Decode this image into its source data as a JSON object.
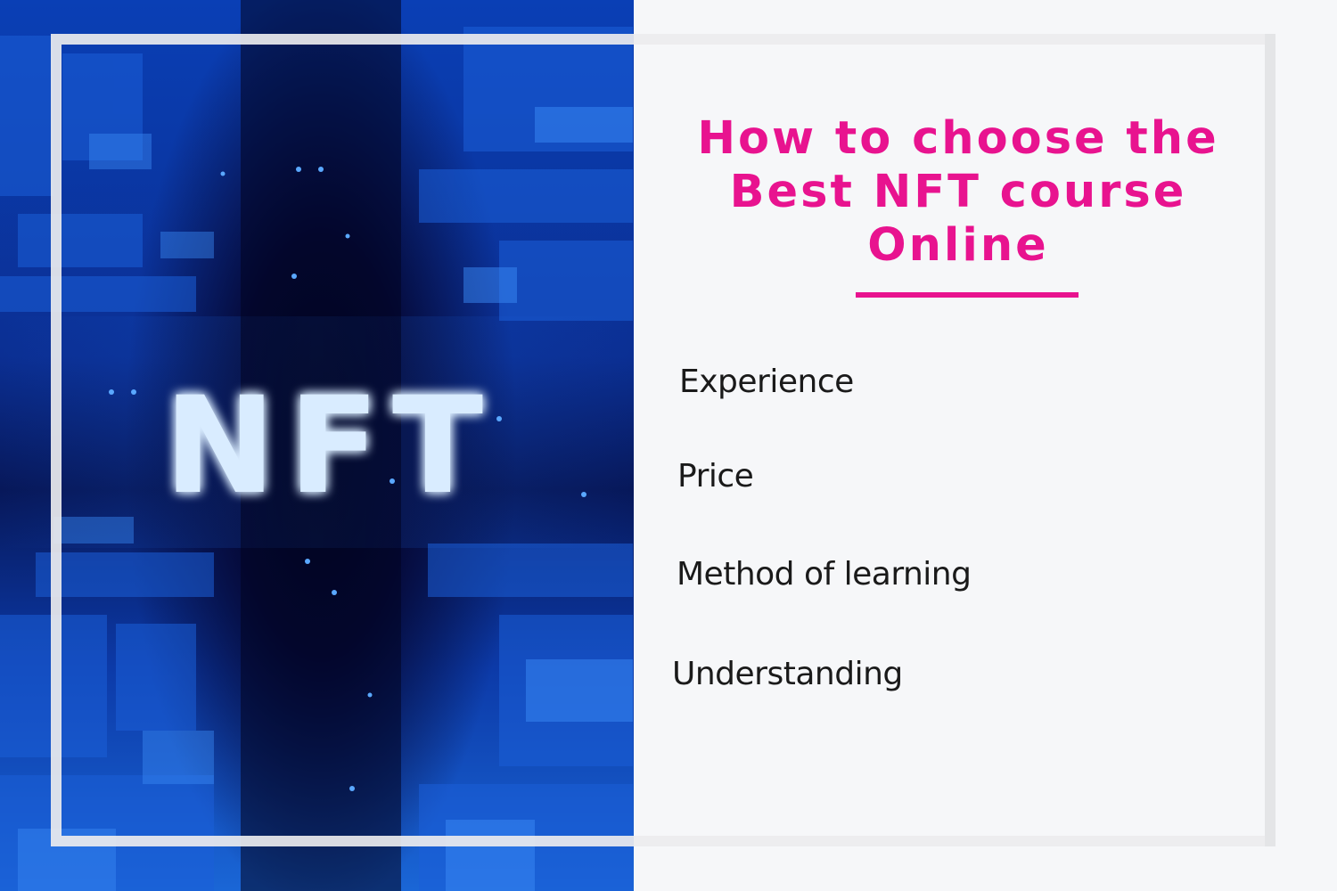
{
  "hero_image": {
    "text": "NFT",
    "description_icon": "nft-cyber-icon"
  },
  "heading": {
    "text": "How to choose the Best NFT course Online"
  },
  "criteria": [
    {
      "label": "Experience"
    },
    {
      "label": "Price"
    },
    {
      "label": "Method of learning"
    },
    {
      "label": "Understanding"
    }
  ],
  "colors": {
    "accent": "#e8138f",
    "background": "#f6f7f9",
    "text": "#1a1a1a",
    "hero_blue": "#0b3fb5"
  }
}
